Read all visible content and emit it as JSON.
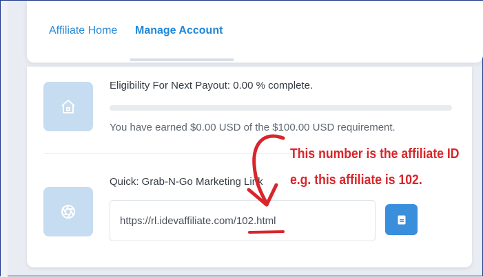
{
  "nav": {
    "tabs": [
      {
        "label": "Affiliate Home"
      },
      {
        "label": "Manage Account"
      }
    ]
  },
  "payout": {
    "label": "Eligibility For Next Payout: 0.00 % complete.",
    "progress_percent": 0,
    "earned_text": "You have earned $0.00 USD of the $100.00 USD requirement."
  },
  "marketing_link": {
    "label": "Quick: Grab-N-Go Marketing Link",
    "url": "https://rl.idevaffiliate.com/102.html"
  },
  "annotation": {
    "line1": "This number is the affiliate ID",
    "line2": "e.g. this affiliate is 102."
  },
  "colors": {
    "accent": "#2a8bd6",
    "icon_bg": "#c6dcf0",
    "annotation_red": "#d8262b"
  },
  "icons": [
    "home-icon",
    "aperture-icon",
    "copy-icon"
  ]
}
